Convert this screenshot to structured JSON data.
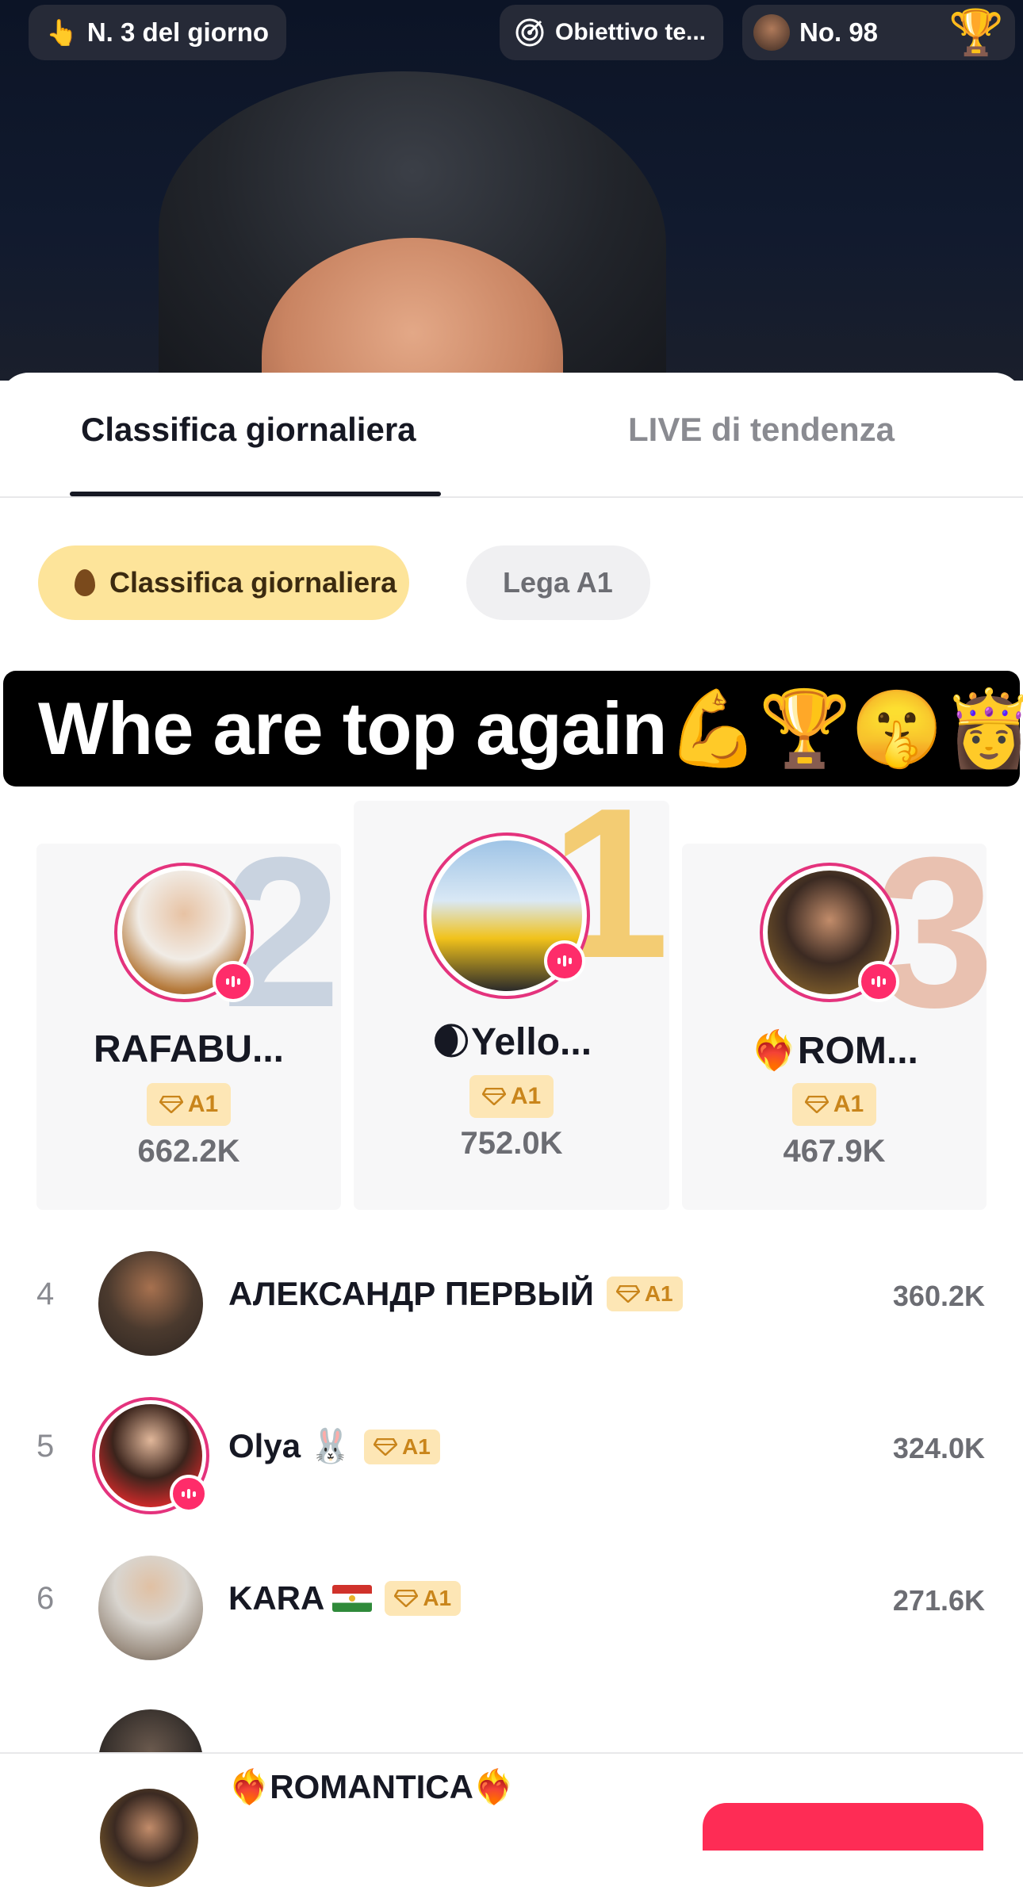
{
  "topbar": {
    "daily_rank": "N. 3 del giorno",
    "goal": "Obiettivo te...",
    "rank_no": "No. 98"
  },
  "tabs": [
    {
      "label": "Classifica giornaliera",
      "active": true
    },
    {
      "label": "LIVE di tendenza",
      "active": false
    }
  ],
  "filters": [
    {
      "label": "Classifica giornaliera",
      "icon": "flame-icon",
      "selected": true
    },
    {
      "label": "Lega A1",
      "selected": false
    }
  ],
  "caption": {
    "text": "Whe are top again💪🏆🤫👸"
  },
  "podium": [
    {
      "rank": "2",
      "name": "RAFABU...",
      "badge": "A1",
      "score": "662.2K",
      "live": true
    },
    {
      "rank": "1",
      "name": "🌒Yello...",
      "badge": "A1",
      "score": "752.0K",
      "live": true
    },
    {
      "rank": "3",
      "name": "❤️‍🔥ROM...",
      "badge": "A1",
      "score": "467.9K",
      "live": true
    }
  ],
  "list": [
    {
      "rank": "4",
      "name": "АЛЕКСАНДР ПЕРВЫЙ",
      "badge": "A1",
      "score": "360.2K",
      "live": false
    },
    {
      "rank": "5",
      "name": "Olya 🐰",
      "badge": "A1",
      "score": "324.0K",
      "live": true
    },
    {
      "rank": "6",
      "name": "KARA",
      "flag": "tajikistan-flag",
      "badge": "A1",
      "score": "271.6K",
      "live": false
    }
  ],
  "bottom": {
    "name": "❤️‍🔥ROMANTICA❤️‍🔥"
  },
  "colors": {
    "accent_pink": "#fe2c55",
    "live_ring": "#e4337d",
    "chip_selected": "#fde49a",
    "badge_bg": "#fde6b5",
    "badge_fg": "#c9851b"
  }
}
